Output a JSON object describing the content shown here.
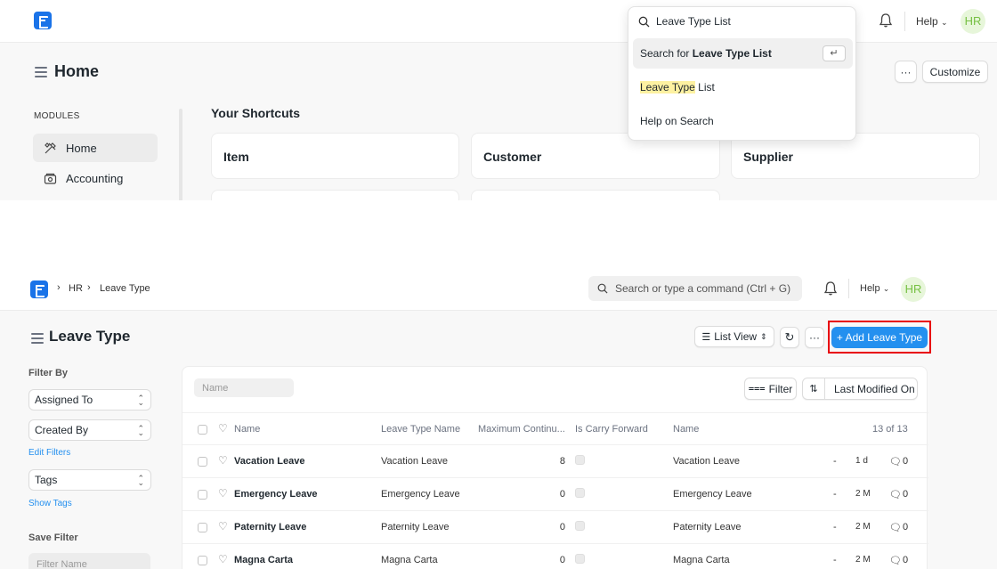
{
  "top": {
    "help_label": "Help",
    "avatar_initials": "HR",
    "page_title": "Home",
    "more_label": "···",
    "customize_label": "Customize",
    "modules_heading": "MODULES",
    "sidebar_items": [
      {
        "label": "Home",
        "icon": "home-tools-icon",
        "active": true
      },
      {
        "label": "Accounting",
        "icon": "accounting-icon",
        "active": false
      }
    ],
    "shortcuts_heading": "Your Shortcuts",
    "shortcuts": [
      "Item",
      "Customer",
      "Supplier"
    ],
    "search": {
      "value": "Leave Type List",
      "results": {
        "search_for_prefix": "Search for ",
        "search_for_term": "Leave Type List",
        "enter_key": "↵",
        "match_highlight": "Leave Type",
        "match_rest": " List",
        "help_on_search": "Help on Search"
      }
    }
  },
  "bottom": {
    "breadcrumb": [
      "HR",
      "Leave Type"
    ],
    "search_placeholder": "Search or type a command (Ctrl + G)",
    "help_label": "Help",
    "avatar_initials": "HR",
    "page_title": "Leave Type",
    "list_view_label": "List View",
    "more_label": "···",
    "add_button_label": "+ Add Leave Type",
    "filter_by_label": "Filter By",
    "filters": [
      "Assigned To",
      "Created By"
    ],
    "edit_filters_label": "Edit Filters",
    "tags_label": "Tags",
    "show_tags_label": "Show Tags",
    "save_filter_label": "Save Filter",
    "filter_name_placeholder": "Filter Name",
    "name_filter_placeholder": "Name",
    "filter_button_label": "Filter",
    "sort_label": "Last Modified On",
    "columns": [
      "Name",
      "Leave Type Name",
      "Maximum Continu...",
      "Is Carry Forward",
      "Name"
    ],
    "count_label": "13 of 13",
    "rows": [
      {
        "name": "Vacation Leave",
        "type_name": "Vacation Leave",
        "max": "8",
        "name2": "Vacation Leave",
        "dash": "-",
        "age": "1 d",
        "comments": "0"
      },
      {
        "name": "Emergency Leave",
        "type_name": "Emergency Leave",
        "max": "0",
        "name2": "Emergency Leave",
        "dash": "-",
        "age": "2 M",
        "comments": "0"
      },
      {
        "name": "Paternity Leave",
        "type_name": "Paternity Leave",
        "max": "0",
        "name2": "Paternity Leave",
        "dash": "-",
        "age": "2 M",
        "comments": "0"
      },
      {
        "name": "Magna Carta",
        "type_name": "Magna Carta",
        "max": "0",
        "name2": "Magna Carta",
        "dash": "-",
        "age": "2 M",
        "comments": "0"
      }
    ]
  },
  "colors": {
    "brand": "#1a73e8",
    "primary_button": "#2490ef",
    "highlight_box": "#e8000b",
    "search_highlight": "#fdf1a1",
    "avatar_bg": "#e7f6da",
    "avatar_fg": "#76c043"
  }
}
